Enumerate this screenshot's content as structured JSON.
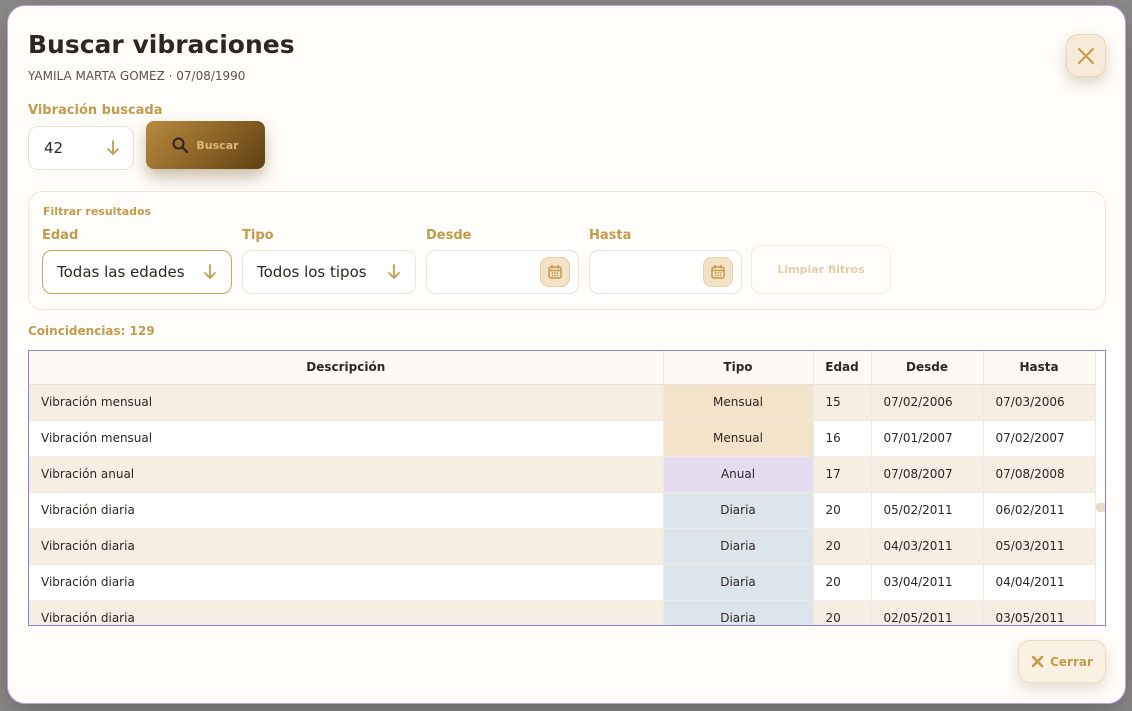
{
  "modal": {
    "title": "Buscar vibraciones",
    "subtitle": "YAMILA MARTA GOMEZ · 07/08/1990"
  },
  "search": {
    "label": "Vibración buscada",
    "value": "42",
    "button_label": "Buscar"
  },
  "filters": {
    "title": "Filtrar resultados",
    "edad_label": "Edad",
    "edad_value": "Todas las edades",
    "tipo_label": "Tipo",
    "tipo_value": "Todos los tipos",
    "desde_label": "Desde",
    "hasta_label": "Hasta",
    "clear_label": "Limpiar filtros"
  },
  "results": {
    "count_label": "Coincidencias: 129",
    "columns": [
      "Descripción",
      "Tipo",
      "Edad",
      "Desde",
      "Hasta"
    ],
    "rows": [
      [
        "Vibración mensual",
        "Mensual",
        "15",
        "07/02/2006",
        "07/03/2006"
      ],
      [
        "Vibración mensual",
        "Mensual",
        "16",
        "07/01/2007",
        "07/02/2007"
      ],
      [
        "Vibración anual",
        "Anual",
        "17",
        "07/08/2007",
        "07/08/2008"
      ],
      [
        "Vibración diaria",
        "Diaria",
        "20",
        "05/02/2011",
        "06/02/2011"
      ],
      [
        "Vibración diaria",
        "Diaria",
        "20",
        "04/03/2011",
        "05/03/2011"
      ],
      [
        "Vibración diaria",
        "Diaria",
        "20",
        "03/04/2011",
        "04/04/2011"
      ],
      [
        "Vibración diaria",
        "Diaria",
        "20",
        "02/05/2011",
        "03/05/2011"
      ]
    ]
  },
  "footer": {
    "close_label": "Cerrar"
  },
  "colors": {
    "accent_gold": "#c49a4c",
    "button_gradient_start": "#b68a3f",
    "button_gradient_end": "#5e4014",
    "mensual": "#f3e3cb",
    "anual": "#e6dcf2",
    "diaria": "#dce4ec"
  }
}
